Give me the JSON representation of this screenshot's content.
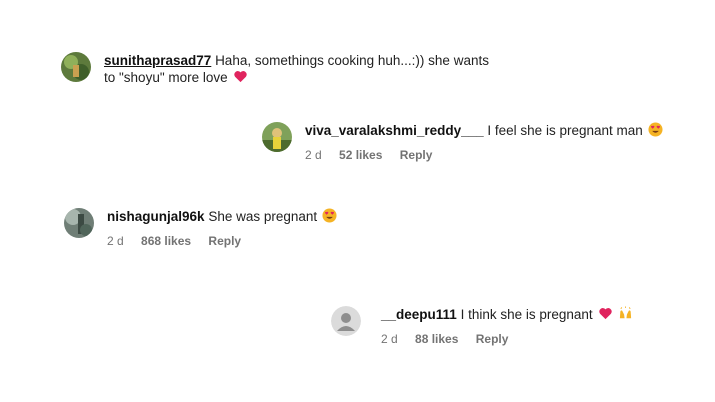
{
  "comments": [
    {
      "username": "sunithaprasad77",
      "text_line1": "Haha, somethings cooking huh...:)) she wants",
      "text_line2": "to \"shoyu\" more love",
      "emoji": "red-heart-icon"
    },
    {
      "username": "viva_varalakshmi_reddy___",
      "text": "I feel she is pregnant man",
      "emoji": "heart-eyes-emoji-icon",
      "age": "2 d",
      "likes": "52 likes",
      "reply": "Reply"
    },
    {
      "username": "nishagunjal96k",
      "text": "She was pregnant",
      "emoji": "heart-eyes-emoji-icon",
      "age": "2 d",
      "likes": "868 likes",
      "reply": "Reply"
    },
    {
      "username": "__deepu111",
      "text": "I think she is pregnant",
      "emojis": [
        "red-heart-icon",
        "raising-hands-icon"
      ],
      "age": "2 d",
      "likes": "88 likes",
      "reply": "Reply"
    }
  ],
  "colors": {
    "meta": "#737373",
    "heart": "#e0245e",
    "emoji_face": "#f5b324"
  }
}
